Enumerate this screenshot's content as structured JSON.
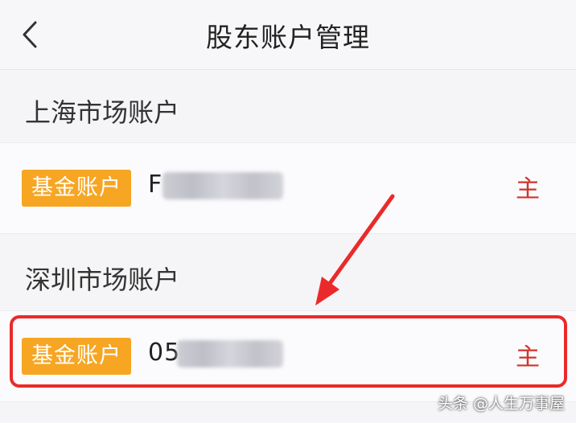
{
  "header": {
    "title": "股东账户管理",
    "back_icon": "chevron-left-icon"
  },
  "sections": [
    {
      "title": "上海市场账户",
      "account": {
        "type_badge": "基金账户",
        "number_prefix": "F",
        "primary_label": "主"
      }
    },
    {
      "title": "深圳市场账户",
      "account": {
        "type_badge": "基金账户",
        "number_prefix": "05",
        "primary_label": "主"
      }
    }
  ],
  "annotation": {
    "highlight_color": "#ea2a2a"
  },
  "watermark": "头条 @人生万事屋",
  "colors": {
    "badge": "#f6a623",
    "primary_text": "#d0342c"
  }
}
